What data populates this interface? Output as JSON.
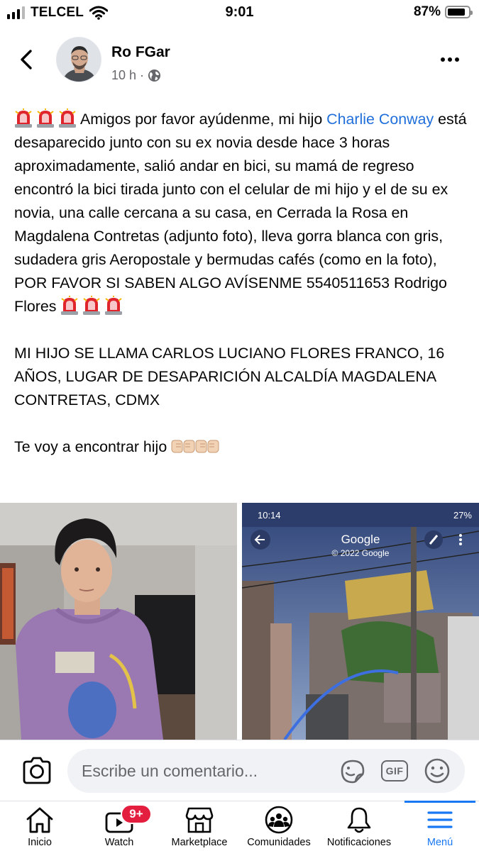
{
  "status_bar": {
    "carrier": "TELCEL",
    "time": "9:01",
    "battery_percent": "87%",
    "battery_level": 0.87
  },
  "post": {
    "author": "Ro FGar",
    "time": "10 h",
    "separator": "·",
    "privacy_icon": "globe-icon",
    "paragraphs": [
      {
        "before": "Amigos por favor ayúdenme, mi hijo ",
        "mention": "Charlie Conway",
        "after": "  está desaparecido junto con su ex novia desde hace 3 horas aproximadamente, salió andar en bici, su mamá de regreso encontró la bici tirada junto con el celular de mi hijo y el de su ex novia, una calle cercana a su casa, en Cerrada la Rosa en Magdalena Contretas (adjunto foto), lleva gorra blanca con gris, sudadera gris Aeropostale y bermudas cafés (como en la foto), POR FAVOR SI SABEN ALGO AVÍSENME 5540511653  Rodrigo Flores"
      },
      {
        "text": "MI HIJO SE LLAMA CARLOS LUCIANO FLORES FRANCO, 16 AÑOS, LUGAR DE DESAPARICIÓN ALCALDÍA MAGDALENA CONTRETAS, CDMX"
      },
      {
        "text": "Te voy a encontrar hijo"
      }
    ],
    "emoji": {
      "siren": "police-light-emoji",
      "fist": "fist-bump-emoji"
    }
  },
  "photos": {
    "streetview": {
      "status_time": "10:14",
      "status_battery": "27%",
      "title": "Google",
      "copyright": "© 2022 Google"
    }
  },
  "comment_bar": {
    "placeholder": "Escribe un comentario...",
    "gif_label": "GIF"
  },
  "bottom_nav": {
    "items": [
      {
        "label": "Inicio",
        "icon": "home-icon"
      },
      {
        "label": "Watch",
        "icon": "watch-video-icon",
        "badge": "9+"
      },
      {
        "label": "Marketplace",
        "icon": "marketplace-shop-icon"
      },
      {
        "label": "Comunidades",
        "icon": "groups-icon"
      },
      {
        "label": "Notificaciones",
        "icon": "bell-icon"
      },
      {
        "label": "Menú",
        "icon": "hamburger-menu-icon",
        "active": true
      }
    ]
  },
  "colors": {
    "link": "#216fdb",
    "accent": "#1877f2",
    "badge": "#e41e3f",
    "secondary_text": "#65676b"
  }
}
